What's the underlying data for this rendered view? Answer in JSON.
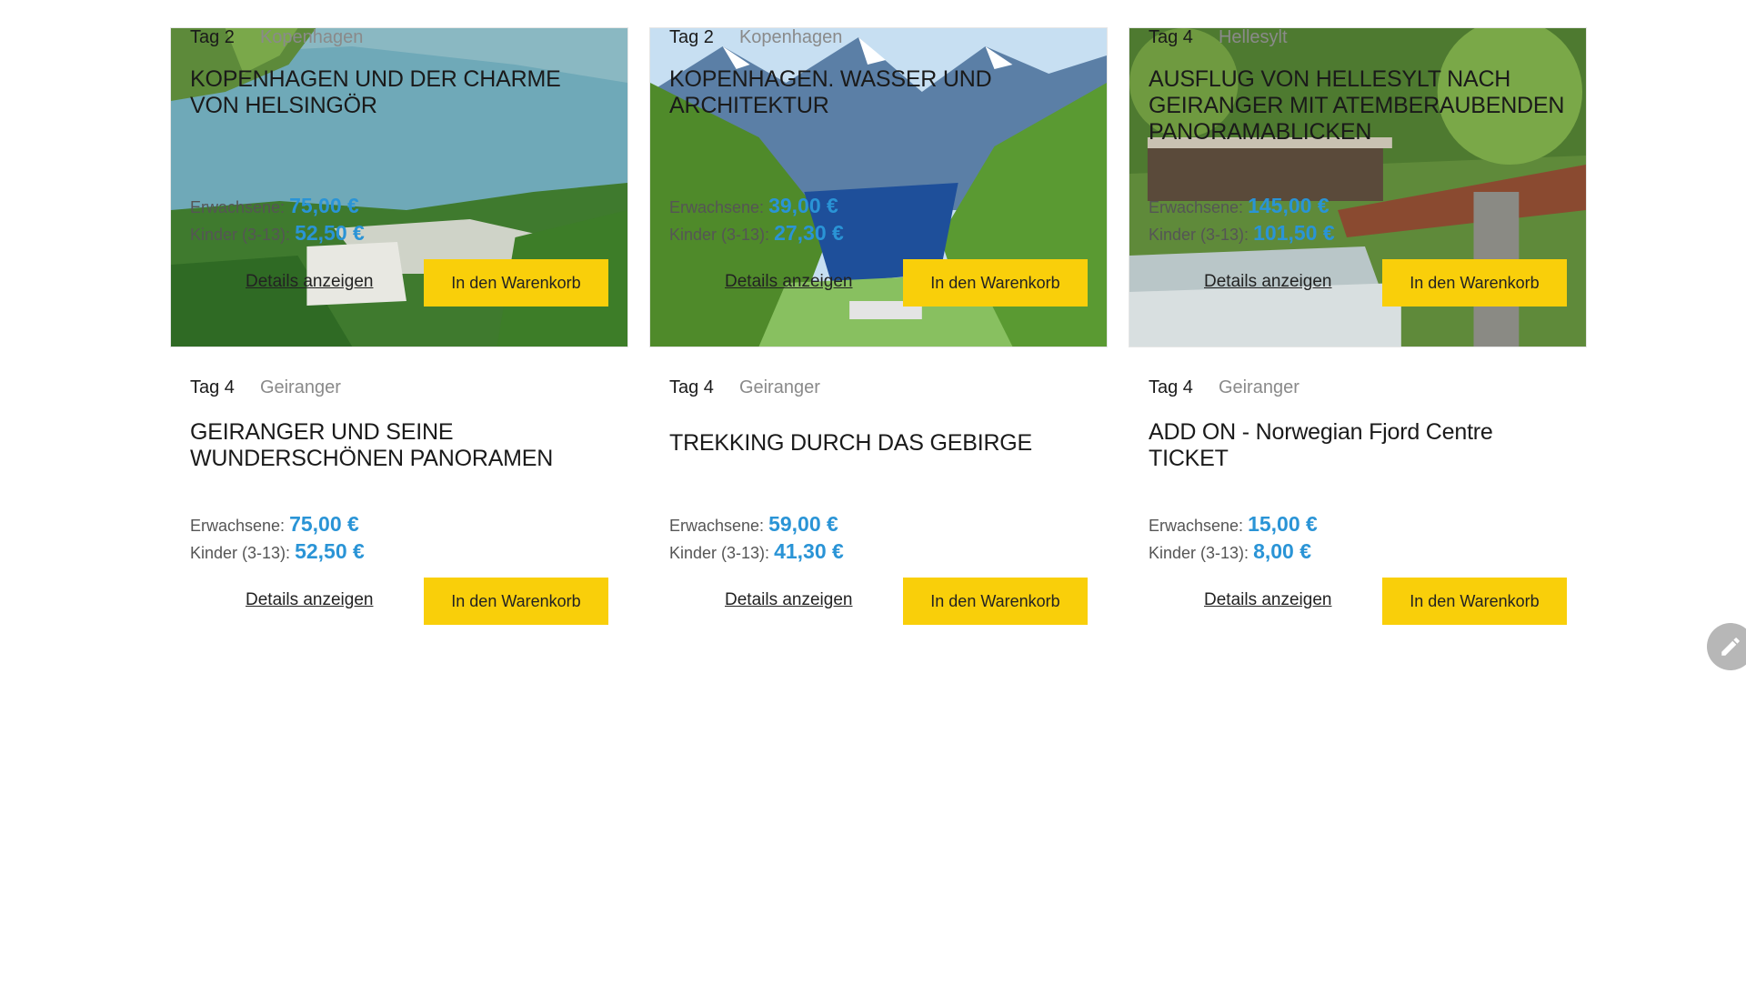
{
  "colors": {
    "accent": "#2a94d6",
    "button": "#f9cf0a"
  },
  "labels": {
    "adults": "Erwachsene:",
    "children": "Kinder (3-13):",
    "details": "Details anzeigen",
    "cart": "In den Warenkorb"
  },
  "cards": [
    {
      "day": "Tag 2",
      "place": "Kopenhagen",
      "title": "KOPENHAGEN UND DER CHARME VON HELSINGÖR",
      "adult_price": "75,00 €",
      "child_price": "52,50 €"
    },
    {
      "day": "Tag 2",
      "place": "Kopenhagen",
      "title": "KOPENHAGEN. WASSER UND ARCHITEKTUR",
      "adult_price": "39,00 €",
      "child_price": "27,30 €"
    },
    {
      "day": "Tag 4",
      "place": "Hellesylt",
      "title": "AUSFLUG VON HELLESYLT NACH GEIRANGER MIT ATEMBERAUBENDEN PANORAMABLICKEN",
      "adult_price": "145,00 €",
      "child_price": "101,50 €"
    },
    {
      "day": "Tag 4",
      "place": "Geiranger",
      "title": "GEIRANGER UND SEINE WUNDERSCHÖNEN PANORAMEN",
      "adult_price": "75,00 €",
      "child_price": "52,50 €"
    },
    {
      "day": "Tag 4",
      "place": "Geiranger",
      "title": "TREKKING DURCH DAS GEBIRGE",
      "adult_price": "59,00 €",
      "child_price": "41,30 €"
    },
    {
      "day": "Tag 4",
      "place": "Geiranger",
      "title": "ADD ON - Norwegian Fjord Centre TICKET",
      "adult_price": "15,00 €",
      "child_price": "8,00 €"
    }
  ]
}
